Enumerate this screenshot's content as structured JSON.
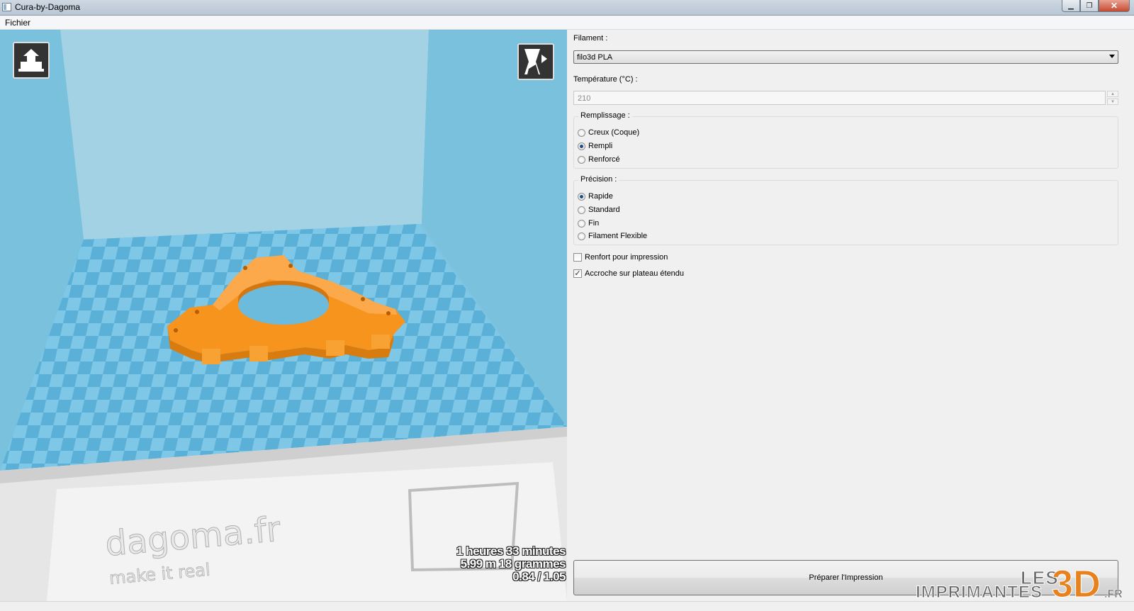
{
  "window": {
    "title": "Cura-by-Dagoma",
    "minimize_glyph": "▁",
    "restore_glyph": "❐",
    "close_glyph": "✕"
  },
  "menu": {
    "file": "Fichier"
  },
  "viewport": {
    "brand_text": "dagoma.fr",
    "brand_tagline": "make it real",
    "print_time": "1 heures 33 minutes",
    "filament_usage": "5.99 m 18 grammes",
    "cost": "0.84 / 1.05",
    "model_color": "#f7941d",
    "bed_color_a": "#7ec7e6",
    "bed_color_b": "#5ab0d6",
    "left_tool_icon": "load-model-icon",
    "right_tool_icon": "view-mode-icon"
  },
  "settings": {
    "filament_label": "Filament :",
    "filament_value": "filo3d PLA",
    "temperature_label": "Température (°C) :",
    "temperature_value": "210",
    "spin_up": "▲",
    "spin_down": "▼",
    "infill": {
      "title": "Remplissage :",
      "options": [
        "Creux (Coque)",
        "Rempli",
        "Renforcé"
      ],
      "selected": "Rempli"
    },
    "precision": {
      "title": "Précision :",
      "options": [
        "Rapide",
        "Standard",
        "Fin",
        "Filament Flexible"
      ],
      "selected": "Rapide"
    },
    "support_label": "Renfort pour impression",
    "support_checked": false,
    "brim_label": "Accroche sur plateau étendu",
    "brim_checked": true,
    "checkmark": "✓",
    "prepare_button": "Préparer l'Impression"
  },
  "watermark": {
    "les": "LES",
    "imprimantes": "IMPRIMANTES",
    "three_d": "3D",
    "fr": ".FR"
  }
}
